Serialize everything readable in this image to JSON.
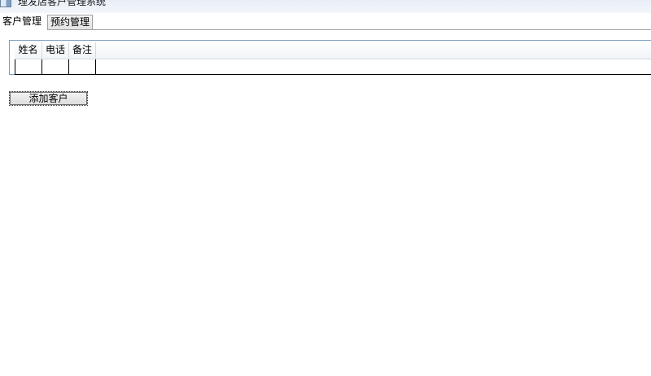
{
  "window": {
    "title": "理发店客户管理系统",
    "icon": "app-window-icon"
  },
  "tabs": [
    {
      "label": "客户管理",
      "active": true
    },
    {
      "label": "预约管理",
      "active": false
    }
  ],
  "customer_table": {
    "columns": [
      "姓名",
      "电话",
      "备注"
    ],
    "rows": [
      [
        "",
        "",
        ""
      ]
    ]
  },
  "actions": {
    "add_customer_label": "添加客户"
  }
}
